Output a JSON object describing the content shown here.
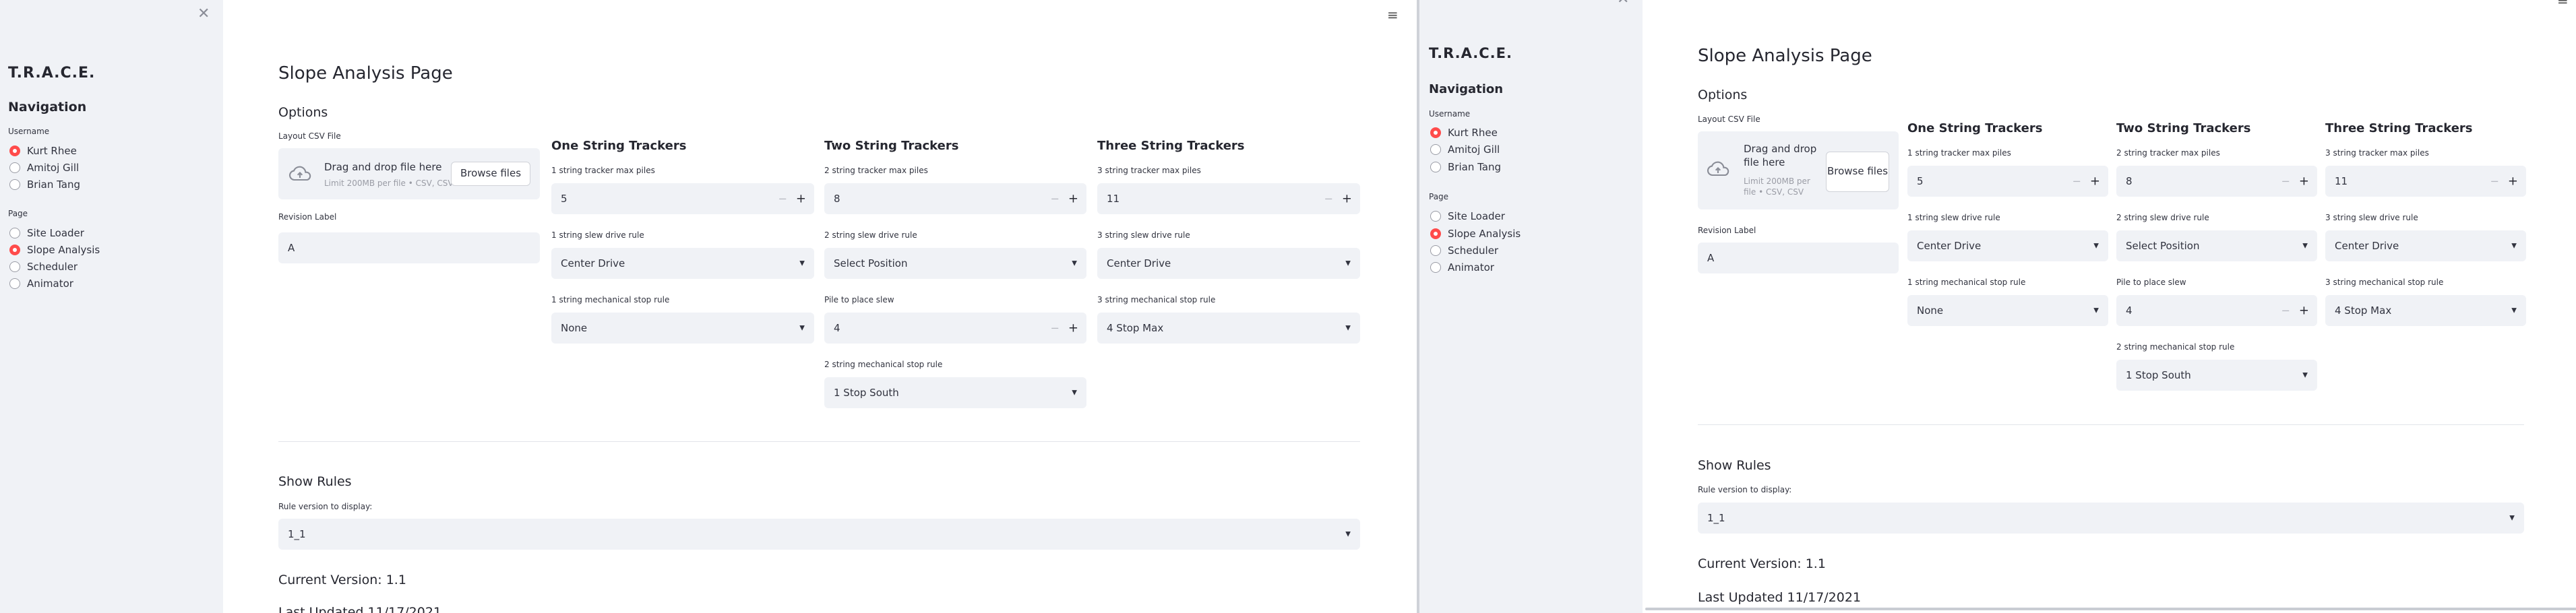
{
  "app": {
    "title": "T.R.A.C.E.",
    "close_glyph": "✕",
    "menu_glyph": "≡"
  },
  "sidebar": {
    "nav_heading": "Navigation",
    "username_label": "Username",
    "users": [
      "Kurt Rhee",
      "Amitoj Gill",
      "Brian Tang"
    ],
    "selected_user": "Kurt Rhee",
    "page_label": "Page",
    "pages": [
      "Site Loader",
      "Slope Analysis",
      "Scheduler",
      "Animator"
    ],
    "selected_page": "Slope Analysis"
  },
  "main": {
    "page_title": "Slope Analysis Page",
    "options_heading": "Options",
    "uploader": {
      "label": "Layout CSV File",
      "drag_text": "Drag and drop file here",
      "limit_text": "Limit 200MB per file • CSV, CSV",
      "browse_label": "Browse files"
    },
    "revision": {
      "label": "Revision Label",
      "value": "A"
    },
    "one_string": {
      "heading": "One String Trackers",
      "max_piles_label": "1 string tracker max piles",
      "max_piles": "5",
      "slew_label": "1 string slew drive rule",
      "slew": "Center Drive",
      "stop_label": "1 string mechanical stop rule",
      "stop": "None"
    },
    "two_string": {
      "heading": "Two String Trackers",
      "max_piles_label": "2 string tracker max piles",
      "max_piles": "8",
      "slew_label": "2 string slew drive rule",
      "slew": "Select Position",
      "pile_slew_label": "Pile to place slew",
      "pile_slew": "4",
      "stop_label": "2 string mechanical stop rule",
      "stop": "1 Stop South"
    },
    "three_string": {
      "heading": "Three String Trackers",
      "max_piles_label": "3 string tracker max piles",
      "max_piles": "11",
      "slew_label": "3 string slew drive rule",
      "slew": "Center Drive",
      "stop_label": "3 string mechanical stop rule",
      "stop": "4 Stop Max"
    },
    "rules": {
      "heading": "Show Rules",
      "version_label": "Rule version to display:",
      "version": "1_1",
      "current_version": "Current Version: 1.1",
      "last_updated": "Last Updated 11/17/2021"
    },
    "minus_glyph": "−",
    "plus_glyph": "+",
    "caret_glyph": "▼"
  },
  "colors": {
    "accent": "#ff4b4b",
    "sidebar_bg": "#f0f2f6",
    "widget_bg": "#f0f2f6",
    "text": "#262730"
  }
}
